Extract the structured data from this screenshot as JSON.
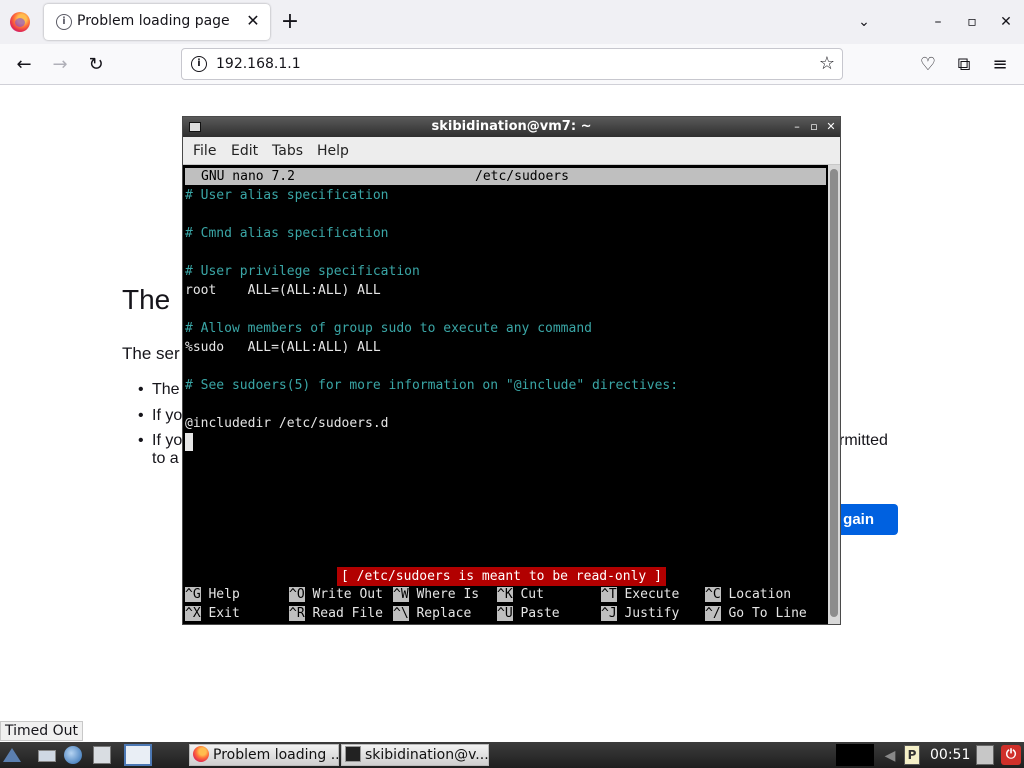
{
  "browser": {
    "tab_title": "Problem loading page",
    "tab_close": "✕",
    "new_tab": "+",
    "list_tabs": "⌄",
    "window_minimize": "–",
    "window_maximize": "▫",
    "window_close": "✕",
    "back": "←",
    "forward": "→",
    "reload": "↻",
    "url": "192.168.1.1",
    "star": "☆",
    "pocket": "♡",
    "extensions": "⧉",
    "menu": "≡",
    "info_glyph": "i"
  },
  "error_page": {
    "title_visible": "The",
    "desc_visible": "The ser",
    "bullets": [
      "The",
      "If yo",
      "If yo"
    ],
    "tail_line1": "rmitted",
    "tail_line2": "to a",
    "button_visible": "gain"
  },
  "terminal": {
    "title": "skibidination@vm7: ~",
    "buttons": {
      "minimize": "–",
      "maximize": "▫",
      "close": "✕"
    },
    "menu": [
      "File",
      "Edit",
      "Tabs",
      "Help"
    ],
    "nano": {
      "version": "GNU nano 7.2",
      "filename": "/etc/sudoers",
      "lines": [
        "# User alias specification",
        "",
        "# Cmnd alias specification",
        "",
        "# User privilege specification",
        "root    ALL=(ALL:ALL) ALL",
        "",
        "# Allow members of group sudo to execute any command",
        "%sudo   ALL=(ALL:ALL) ALL",
        "",
        "# See sudoers(5) for more information on \"@include\" directives:",
        "",
        "@includedir /etc/sudoers.d"
      ],
      "status": "[ /etc/sudoers is meant to be read-only ]",
      "shortcuts_row1": [
        {
          "key": "^G",
          "label": "Help"
        },
        {
          "key": "^O",
          "label": "Write Out"
        },
        {
          "key": "^W",
          "label": "Where Is"
        },
        {
          "key": "^K",
          "label": "Cut"
        },
        {
          "key": "^T",
          "label": "Execute"
        },
        {
          "key": "^C",
          "label": "Location"
        }
      ],
      "shortcuts_row2": [
        {
          "key": "^X",
          "label": "Exit"
        },
        {
          "key": "^R",
          "label": "Read File"
        },
        {
          "key": "^\\",
          "label": "Replace"
        },
        {
          "key": "^U",
          "label": "Paste"
        },
        {
          "key": "^J",
          "label": "Justify"
        },
        {
          "key": "^/",
          "label": "Go To Line"
        }
      ]
    }
  },
  "status_text": "Timed Out",
  "taskbar": {
    "tasks": [
      "Problem loading ...",
      "skibidination@v..."
    ],
    "clipboard_glyph": "P",
    "volume_glyph": "◀",
    "power_glyph": "⏻",
    "clock": "00:51"
  }
}
